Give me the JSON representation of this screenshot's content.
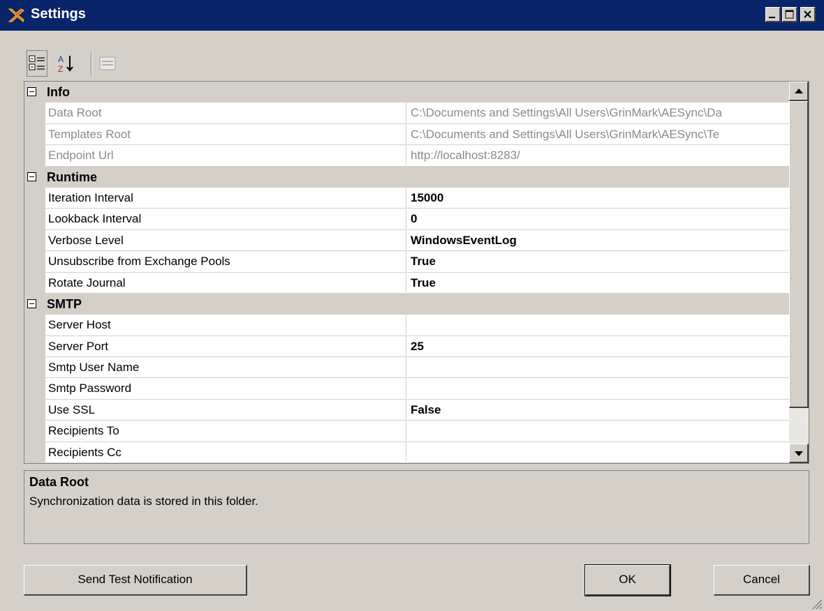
{
  "window": {
    "title": "Settings"
  },
  "toolbar": {
    "categorized": "categorized-view-icon",
    "alphabetical": "alphabetical-sort-icon",
    "property_pages": "property-pages-icon"
  },
  "grid": {
    "categories": [
      {
        "name": "Info",
        "properties": [
          {
            "name": "Data Root",
            "value": "C:\\Documents and Settings\\All Users\\GrinMark\\AESync\\Da",
            "readonly": true
          },
          {
            "name": "Templates Root",
            "value": "C:\\Documents and Settings\\All Users\\GrinMark\\AESync\\Te",
            "readonly": true
          },
          {
            "name": "Endpoint Url",
            "value": "http://localhost:8283/",
            "readonly": true
          }
        ]
      },
      {
        "name": "Runtime",
        "properties": [
          {
            "name": "Iteration Interval",
            "value": "15000"
          },
          {
            "name": "Lookback Interval",
            "value": "0"
          },
          {
            "name": "Verbose Level",
            "value": "WindowsEventLog"
          },
          {
            "name": "Unsubscribe from Exchange Pools",
            "value": "True"
          },
          {
            "name": "Rotate Journal",
            "value": "True"
          }
        ]
      },
      {
        "name": "SMTP",
        "properties": [
          {
            "name": "Server Host",
            "value": ""
          },
          {
            "name": "Server Port",
            "value": "25"
          },
          {
            "name": "Smtp User Name",
            "value": ""
          },
          {
            "name": "Smtp Password",
            "value": ""
          },
          {
            "name": "Use SSL",
            "value": "False"
          },
          {
            "name": "Recipients To",
            "value": ""
          },
          {
            "name": "Recipients Cc",
            "value": ""
          }
        ]
      }
    ]
  },
  "description": {
    "title": "Data Root",
    "text": "Synchronization data is stored in this folder."
  },
  "buttons": {
    "send_test": "Send Test Notification",
    "ok": "OK",
    "cancel": "Cancel"
  }
}
